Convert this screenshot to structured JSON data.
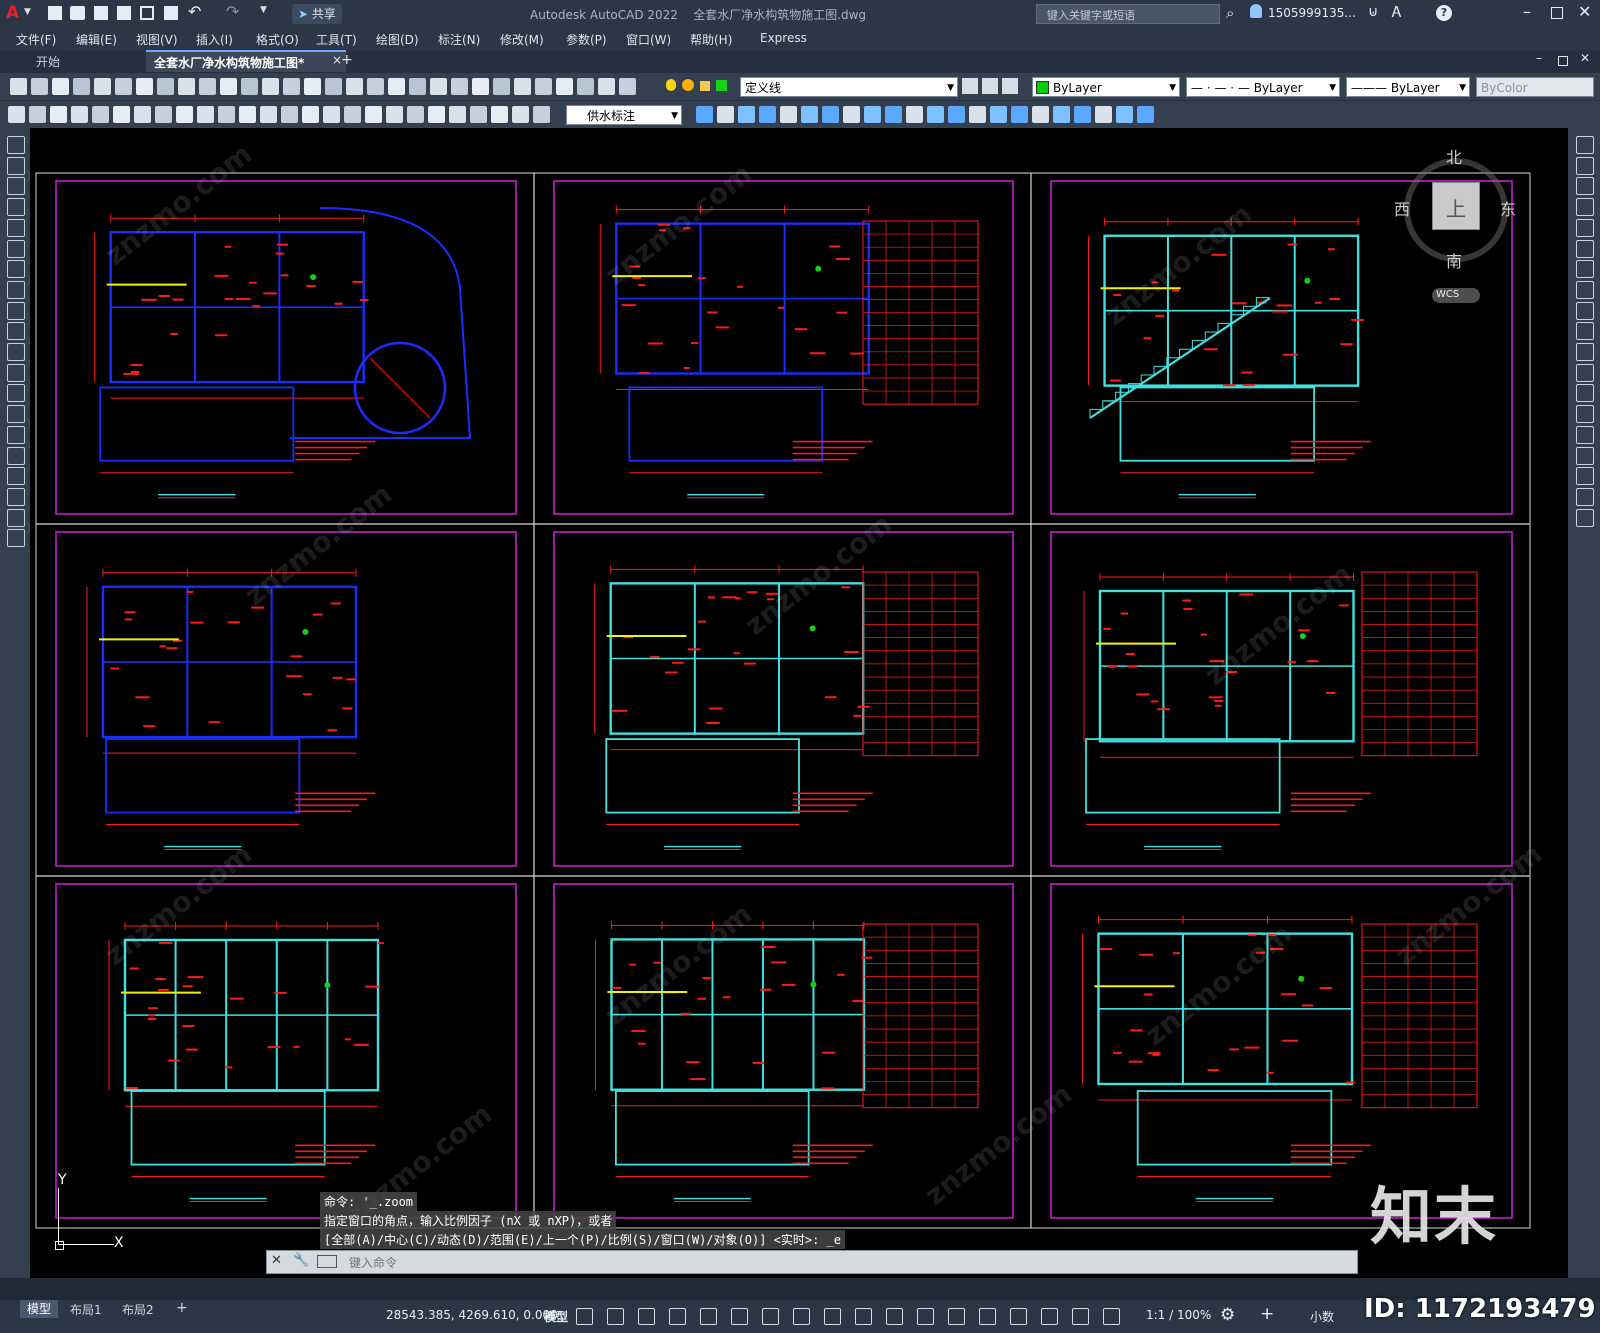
{
  "titlebar": {
    "app_title": "Autodesk AutoCAD 2022",
    "doc_title": "全套水厂净水构筑物施工图.dwg",
    "share_label": "共享",
    "search_placeholder": "键入关键字或短语",
    "user": "1505999135...",
    "logo_letter": "A"
  },
  "menubar": {
    "items": [
      "文件(F)",
      "编辑(E)",
      "视图(V)",
      "插入(I)",
      "格式(O)",
      "工具(T)",
      "绘图(D)",
      "标注(N)",
      "修改(M)",
      "参数(P)",
      "窗口(W)",
      "帮助(H)",
      "Express"
    ]
  },
  "tabs": {
    "start": "开始",
    "active": "全套水厂净水构筑物施工图*",
    "add": "+"
  },
  "toolbar": {
    "layer": "定义线",
    "color": "ByLayer",
    "linetype": "ByLayer",
    "lineweight": "ByLayer",
    "plotstyle": "ByColor",
    "dimstyle": "供水标注"
  },
  "viewcube": {
    "north": "北",
    "south": "南",
    "east": "东",
    "west": "西",
    "top": "上",
    "wcs": "WCS"
  },
  "ucs": {
    "y": "Y",
    "x": "X"
  },
  "command": {
    "history1": "命令: '_.zoom",
    "history2": "指定窗口的角点，输入比例因子 (nX 或 nXP)，或者",
    "history3": "[全部(A)/中心(C)/动态(D)/范围(E)/上一个(P)/比例(S)/窗口(W)/对象(O)] <实时>: _e",
    "placeholder": "键入命令"
  },
  "layout_tabs": [
    "模型",
    "布局1",
    "布局2",
    "+"
  ],
  "statusbar": {
    "coords": "28543.385, 4269.610, 0.000",
    "space": "模型",
    "scale": "1:1 / 100%",
    "units": "小数"
  },
  "watermark": {
    "brand": "知末",
    "id": "ID: 1172193479",
    "repeat": "znzmo.com"
  },
  "colors": {
    "magenta_frame": "#c21ecf",
    "cad_red": "#ff1a1a",
    "cad_cyan": "#3fe0e0",
    "cad_blue": "#1a2cff",
    "cad_yellow": "#f3f300",
    "cad_green": "#16d016"
  }
}
